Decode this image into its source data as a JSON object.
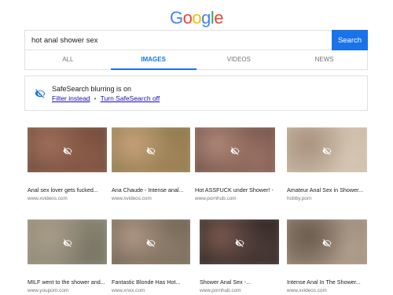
{
  "logo": {
    "letters": [
      {
        "char": "G",
        "color": "#4285f4"
      },
      {
        "char": "o",
        "color": "#ea4335"
      },
      {
        "char": "o",
        "color": "#fbbc05"
      },
      {
        "char": "g",
        "color": "#4285f4"
      },
      {
        "char": "l",
        "color": "#34a853"
      },
      {
        "char": "e",
        "color": "#ea4335"
      }
    ]
  },
  "search": {
    "query": "hot anal shower sex",
    "button_label": "Search"
  },
  "tabs": [
    {
      "label": "ALL",
      "active": false
    },
    {
      "label": "IMAGES",
      "active": true
    },
    {
      "label": "VIDEOS",
      "active": false
    },
    {
      "label": "NEWS",
      "active": false
    }
  ],
  "safesearch": {
    "title": "SafeSearch blurring is on",
    "filter_link": "Filter instead",
    "separator": "•",
    "turn_off_link": "Turn SafeSearch off",
    "icon": "eye-slash-icon"
  },
  "results": [
    {
      "title": "Anal sex lover gets fucked...",
      "source": "www.xvideos.com",
      "colors": [
        "#6e4a3c",
        "#a0705a",
        "#8a5a48"
      ]
    },
    {
      "title": "Ana Chaude - Intense anal...",
      "source": "www.xvideos.com",
      "colors": [
        "#8c7a4e",
        "#c9a27a",
        "#a08458"
      ]
    },
    {
      "title": "Hot ASSFUCK under Shower! -...",
      "source": "www.pornhub.com",
      "colors": [
        "#6e5046",
        "#b08878",
        "#9a7064"
      ]
    },
    {
      "title": "Amateur Anal Sex in Shower...",
      "source": "hobby.porn",
      "colors": [
        "#c8b8a6",
        "#a8927e",
        "#d6c6b4"
      ]
    },
    {
      "title": "MILF went to the shower and...",
      "source": "www.youporn.com",
      "colors": [
        "#8e8a76",
        "#a89c88",
        "#7a7666"
      ]
    },
    {
      "title": "Fantastic Blonde Has Hot...",
      "source": "www.xnxx.com",
      "colors": [
        "#6e6252",
        "#b09886",
        "#8a7a68"
      ]
    },
    {
      "title": "Shower Anal Sex -...",
      "source": "www.pornhub.com",
      "colors": [
        "#2e2624",
        "#7a5a50",
        "#4a3a36"
      ]
    },
    {
      "title": "Intense Anal In The Shower...",
      "source": "www.xvideos.com",
      "colors": [
        "#9a8a7a",
        "#6a5a4c",
        "#b09e8c"
      ]
    }
  ]
}
